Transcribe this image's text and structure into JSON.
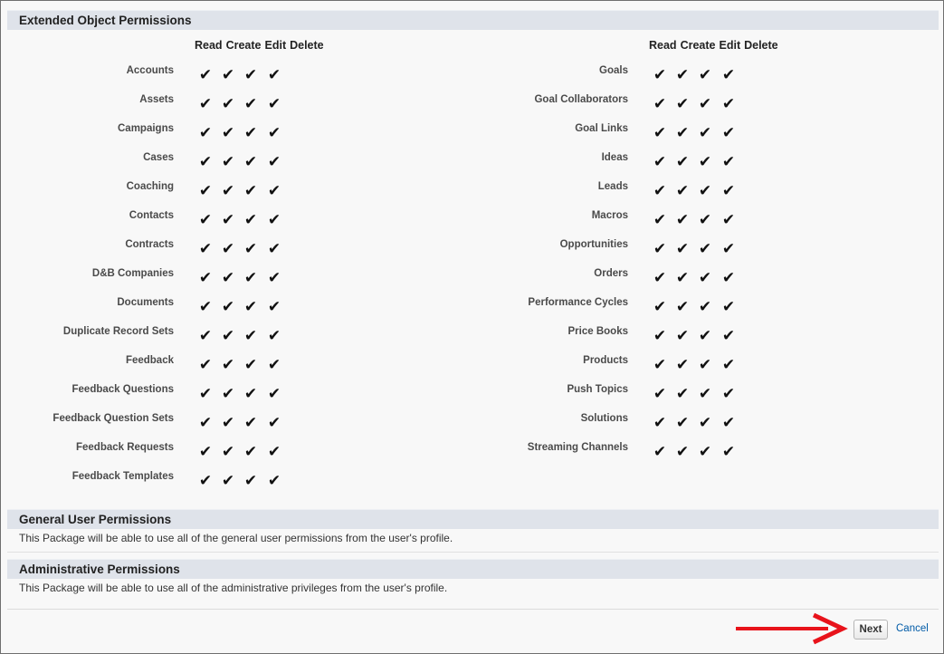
{
  "sections": {
    "extended": {
      "title": "Extended Object Permissions"
    },
    "general": {
      "title": "General User Permissions",
      "description": "This Package will be able to use all of the general user permissions from the user's profile."
    },
    "admin": {
      "title": "Administrative Permissions",
      "description": "This Package will be able to use all of the administrative privileges from the user's profile."
    }
  },
  "columns": [
    "Read",
    "Create",
    "Edit",
    "Delete"
  ],
  "check_glyph": "✔",
  "left_objects": [
    {
      "name": "Accounts",
      "read": true,
      "create": true,
      "edit": true,
      "delete": true
    },
    {
      "name": "Assets",
      "read": true,
      "create": true,
      "edit": true,
      "delete": true
    },
    {
      "name": "Campaigns",
      "read": true,
      "create": true,
      "edit": true,
      "delete": true
    },
    {
      "name": "Cases",
      "read": true,
      "create": true,
      "edit": true,
      "delete": true
    },
    {
      "name": "Coaching",
      "read": true,
      "create": true,
      "edit": true,
      "delete": true
    },
    {
      "name": "Contacts",
      "read": true,
      "create": true,
      "edit": true,
      "delete": true
    },
    {
      "name": "Contracts",
      "read": true,
      "create": true,
      "edit": true,
      "delete": true
    },
    {
      "name": "D&B Companies",
      "read": true,
      "create": true,
      "edit": true,
      "delete": true
    },
    {
      "name": "Documents",
      "read": true,
      "create": true,
      "edit": true,
      "delete": true
    },
    {
      "name": "Duplicate Record Sets",
      "read": true,
      "create": true,
      "edit": true,
      "delete": true
    },
    {
      "name": "Feedback",
      "read": true,
      "create": true,
      "edit": true,
      "delete": true
    },
    {
      "name": "Feedback Questions",
      "read": true,
      "create": true,
      "edit": true,
      "delete": true
    },
    {
      "name": "Feedback Question Sets",
      "read": true,
      "create": true,
      "edit": true,
      "delete": true
    },
    {
      "name": "Feedback Requests",
      "read": true,
      "create": true,
      "edit": true,
      "delete": true
    },
    {
      "name": "Feedback Templates",
      "read": true,
      "create": true,
      "edit": true,
      "delete": true
    }
  ],
  "right_objects": [
    {
      "name": "Goals",
      "read": true,
      "create": true,
      "edit": true,
      "delete": true
    },
    {
      "name": "Goal Collaborators",
      "read": true,
      "create": true,
      "edit": true,
      "delete": true
    },
    {
      "name": "Goal Links",
      "read": true,
      "create": true,
      "edit": true,
      "delete": true
    },
    {
      "name": "Ideas",
      "read": true,
      "create": true,
      "edit": true,
      "delete": true
    },
    {
      "name": "Leads",
      "read": true,
      "create": true,
      "edit": true,
      "delete": true
    },
    {
      "name": "Macros",
      "read": true,
      "create": true,
      "edit": true,
      "delete": true
    },
    {
      "name": "Opportunities",
      "read": true,
      "create": true,
      "edit": true,
      "delete": true
    },
    {
      "name": "Orders",
      "read": true,
      "create": true,
      "edit": true,
      "delete": true
    },
    {
      "name": "Performance Cycles",
      "read": true,
      "create": true,
      "edit": true,
      "delete": true
    },
    {
      "name": "Price Books",
      "read": true,
      "create": true,
      "edit": true,
      "delete": true
    },
    {
      "name": "Products",
      "read": true,
      "create": true,
      "edit": true,
      "delete": true
    },
    {
      "name": "Push Topics",
      "read": true,
      "create": true,
      "edit": true,
      "delete": true
    },
    {
      "name": "Solutions",
      "read": true,
      "create": true,
      "edit": true,
      "delete": true
    },
    {
      "name": "Streaming Channels",
      "read": true,
      "create": true,
      "edit": true,
      "delete": true
    }
  ],
  "footer": {
    "next_label": "Next",
    "cancel_label": "Cancel"
  },
  "colors": {
    "header_bg": "#dfe3ea",
    "link": "#015ba7",
    "arrow": "#e8131b"
  }
}
